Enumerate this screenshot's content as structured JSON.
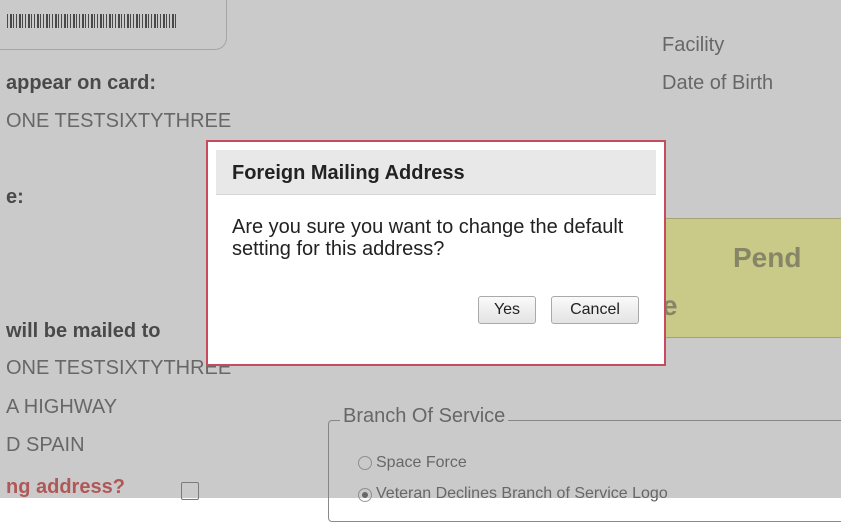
{
  "background": {
    "facility_label": "Facility",
    "dob_label": "Date of Birth",
    "appear_on_card_label": "appear on card:",
    "card_name": "ONE TESTSIXTYTHREE",
    "partial_label_e": "e:",
    "mailed_to_label": "will be mailed to",
    "mail_name": "ONE TESTSIXTYTHREE",
    "address_line1": "A HIGHWAY",
    "address_line2": "D SPAIN",
    "question_label": "ng address?",
    "pending_label": "Pend",
    "pending_e": "e",
    "branch_legend": "Branch Of Service",
    "branch_options": [
      {
        "label": "Space Force",
        "checked": false
      },
      {
        "label": "Veteran Declines Branch of Service Logo",
        "checked": true
      }
    ]
  },
  "dialog": {
    "title": "Foreign Mailing Address",
    "message": "Are you sure you want to change the default setting for this address?",
    "yes_label": "Yes",
    "cancel_label": "Cancel"
  },
  "colors": {
    "dialog_border": "#c74b5c",
    "pending_bg": "#fdfd8d",
    "warning_text": "#d23a3a"
  }
}
